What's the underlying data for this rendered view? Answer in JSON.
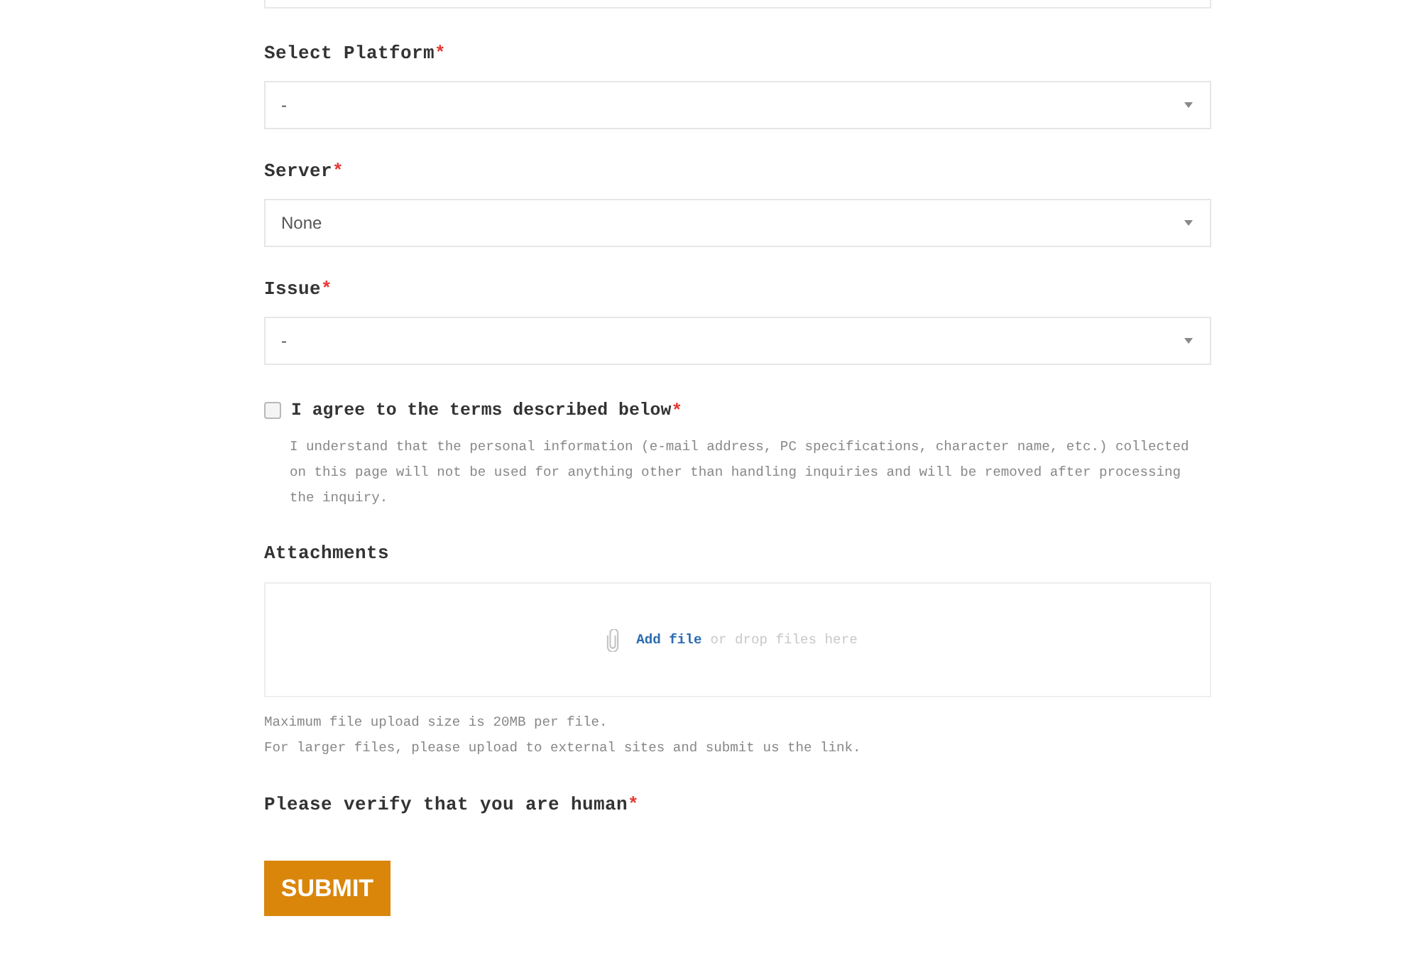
{
  "form": {
    "fields": [
      {
        "kind": "cut"
      },
      {
        "kind": "select",
        "label": "Select Platform",
        "required_mark": "*",
        "value": "-"
      },
      {
        "kind": "select",
        "label": "Server",
        "required_mark": "*",
        "value": "None"
      },
      {
        "kind": "select",
        "label": "Issue",
        "required_mark": "*",
        "value": "-"
      }
    ],
    "consent": {
      "label": "I agree to the terms described below",
      "required_mark": "*",
      "checked": false,
      "text": "I understand that the personal information (e-mail address, PC specifications, character name, etc.) collected on this page will not be used for anything other than handling inquiries and will be removed after processing the inquiry."
    },
    "attachments": {
      "label": "Attachments",
      "link": "Add file",
      "hint": "or drop files here",
      "notes": [
        "Maximum file upload size is 20MB per file.",
        "For larger files, please upload to external sites and submit us the link."
      ]
    },
    "verify": {
      "label": "Please verify that you are human",
      "required_mark": "*"
    },
    "submit": "SUBMIT"
  }
}
